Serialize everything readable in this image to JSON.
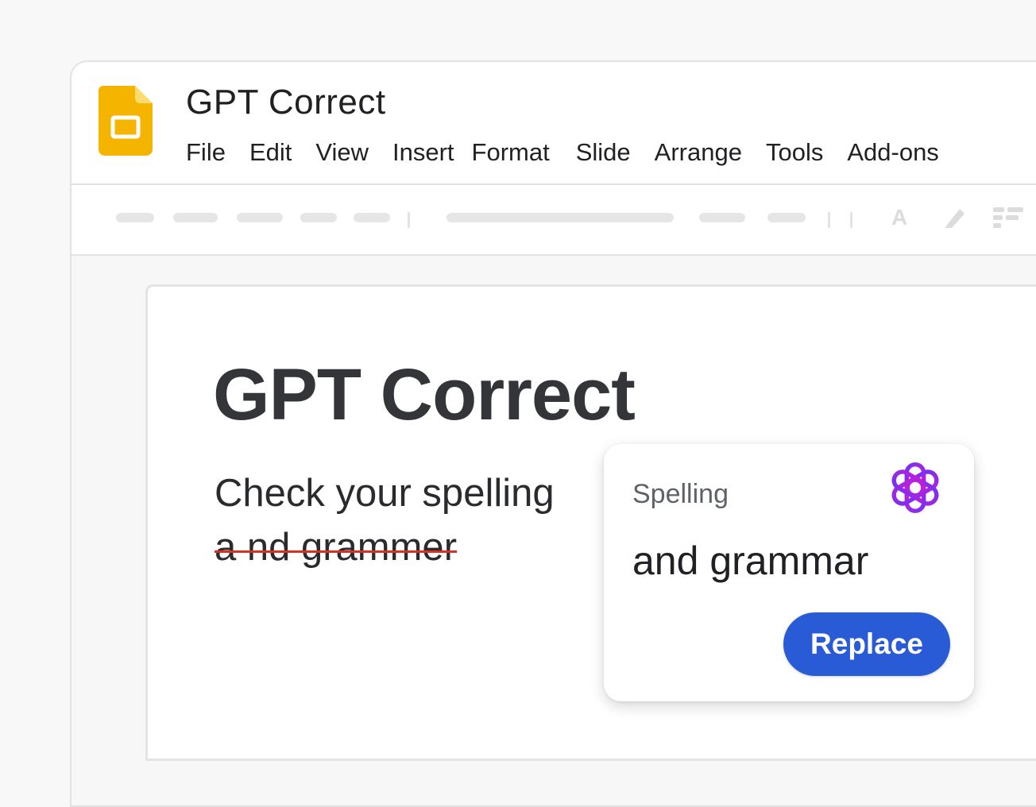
{
  "app": {
    "title": "GPT Correct",
    "icon": "slides-icon",
    "icon_color": "#F4B400"
  },
  "menu": [
    {
      "label": "File"
    },
    {
      "label": "Edit"
    },
    {
      "label": "View"
    },
    {
      "label": "Insert"
    },
    {
      "label": "Format"
    },
    {
      "label": "Slide"
    },
    {
      "label": "Arrange"
    },
    {
      "label": "Tools"
    },
    {
      "label": "Add-ons"
    }
  ],
  "toolbar": {
    "icons": [
      "text-color-icon",
      "highlighter-icon",
      "align-icon"
    ],
    "text_icon_glyph": "A"
  },
  "slide": {
    "title": "GPT Correct",
    "body_line_1": "Check your spelling",
    "body_line_2_misspelled": "a nd grammer"
  },
  "popup": {
    "label": "Spelling",
    "suggestion": "and grammar",
    "replace_label": "Replace",
    "icon": "openai-logo-icon",
    "accent_color": "#2A5BD7",
    "icon_color": "#9B2EE0"
  },
  "colors": {
    "misspelling_underline": "#D93025"
  }
}
